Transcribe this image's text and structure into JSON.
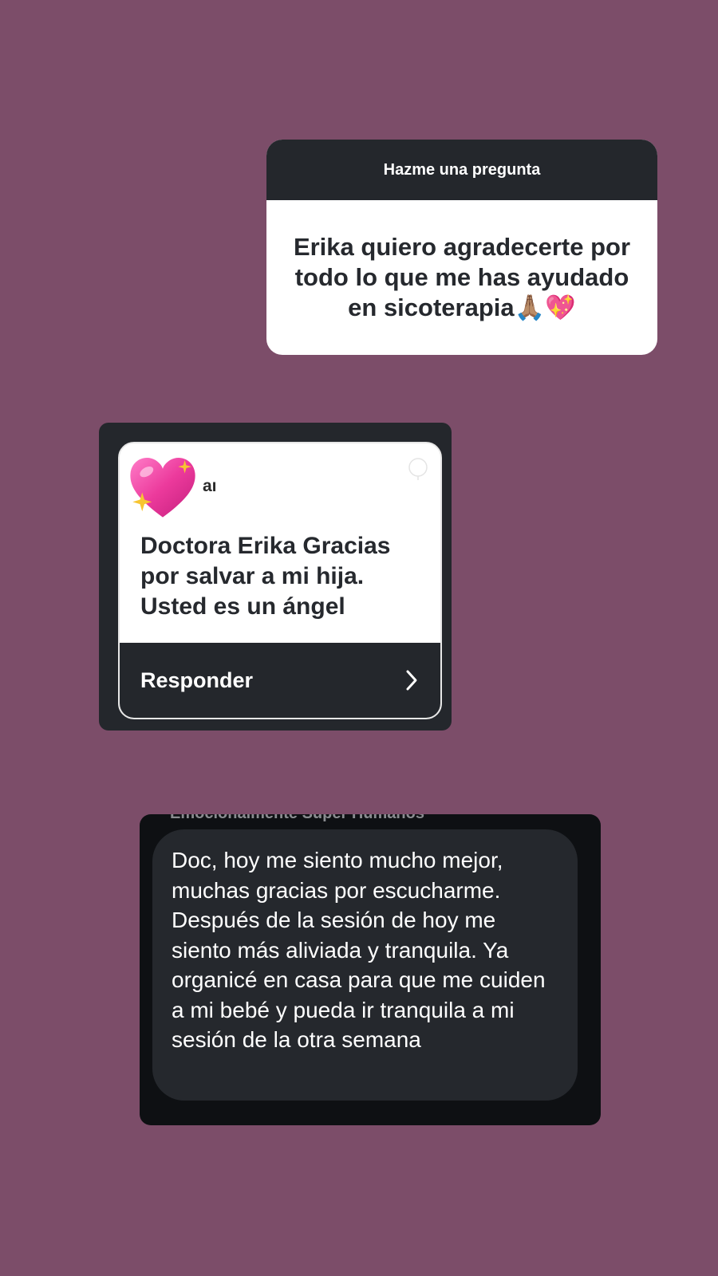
{
  "question_sticker": {
    "header": "Hazme una pregunta",
    "answer": "Erika quiero agradecerte por todo lo que me has ayudado en sicoterapia",
    "emojis": "🙏🏽💖"
  },
  "reply_card": {
    "avatar_icon": "sparkling-heart-icon",
    "handle": "aı",
    "message": "Doctora Erika Gracias por salvar a mi hija. Usted es un ángel",
    "action_label": "Responder",
    "action_icon": "chevron-right-icon"
  },
  "dm_message": {
    "cutoff_text": "Emocionalmente Super Humanos",
    "text": "Doc, hoy me siento mucho mejor, muchas gracias por escucharme. Después de la sesión de hoy me siento más aliviada y tranquila. Ya organicé en casa para que me cuiden a mi bebé y pueda ir tranquila a mi sesión de la otra semana"
  },
  "colors": {
    "background": "#7c4d69",
    "dark_panel": "#24272c",
    "dm_frame": "#0e1013",
    "heart_pink": "#e6379a",
    "sparkle_yellow": "#f7c531"
  }
}
